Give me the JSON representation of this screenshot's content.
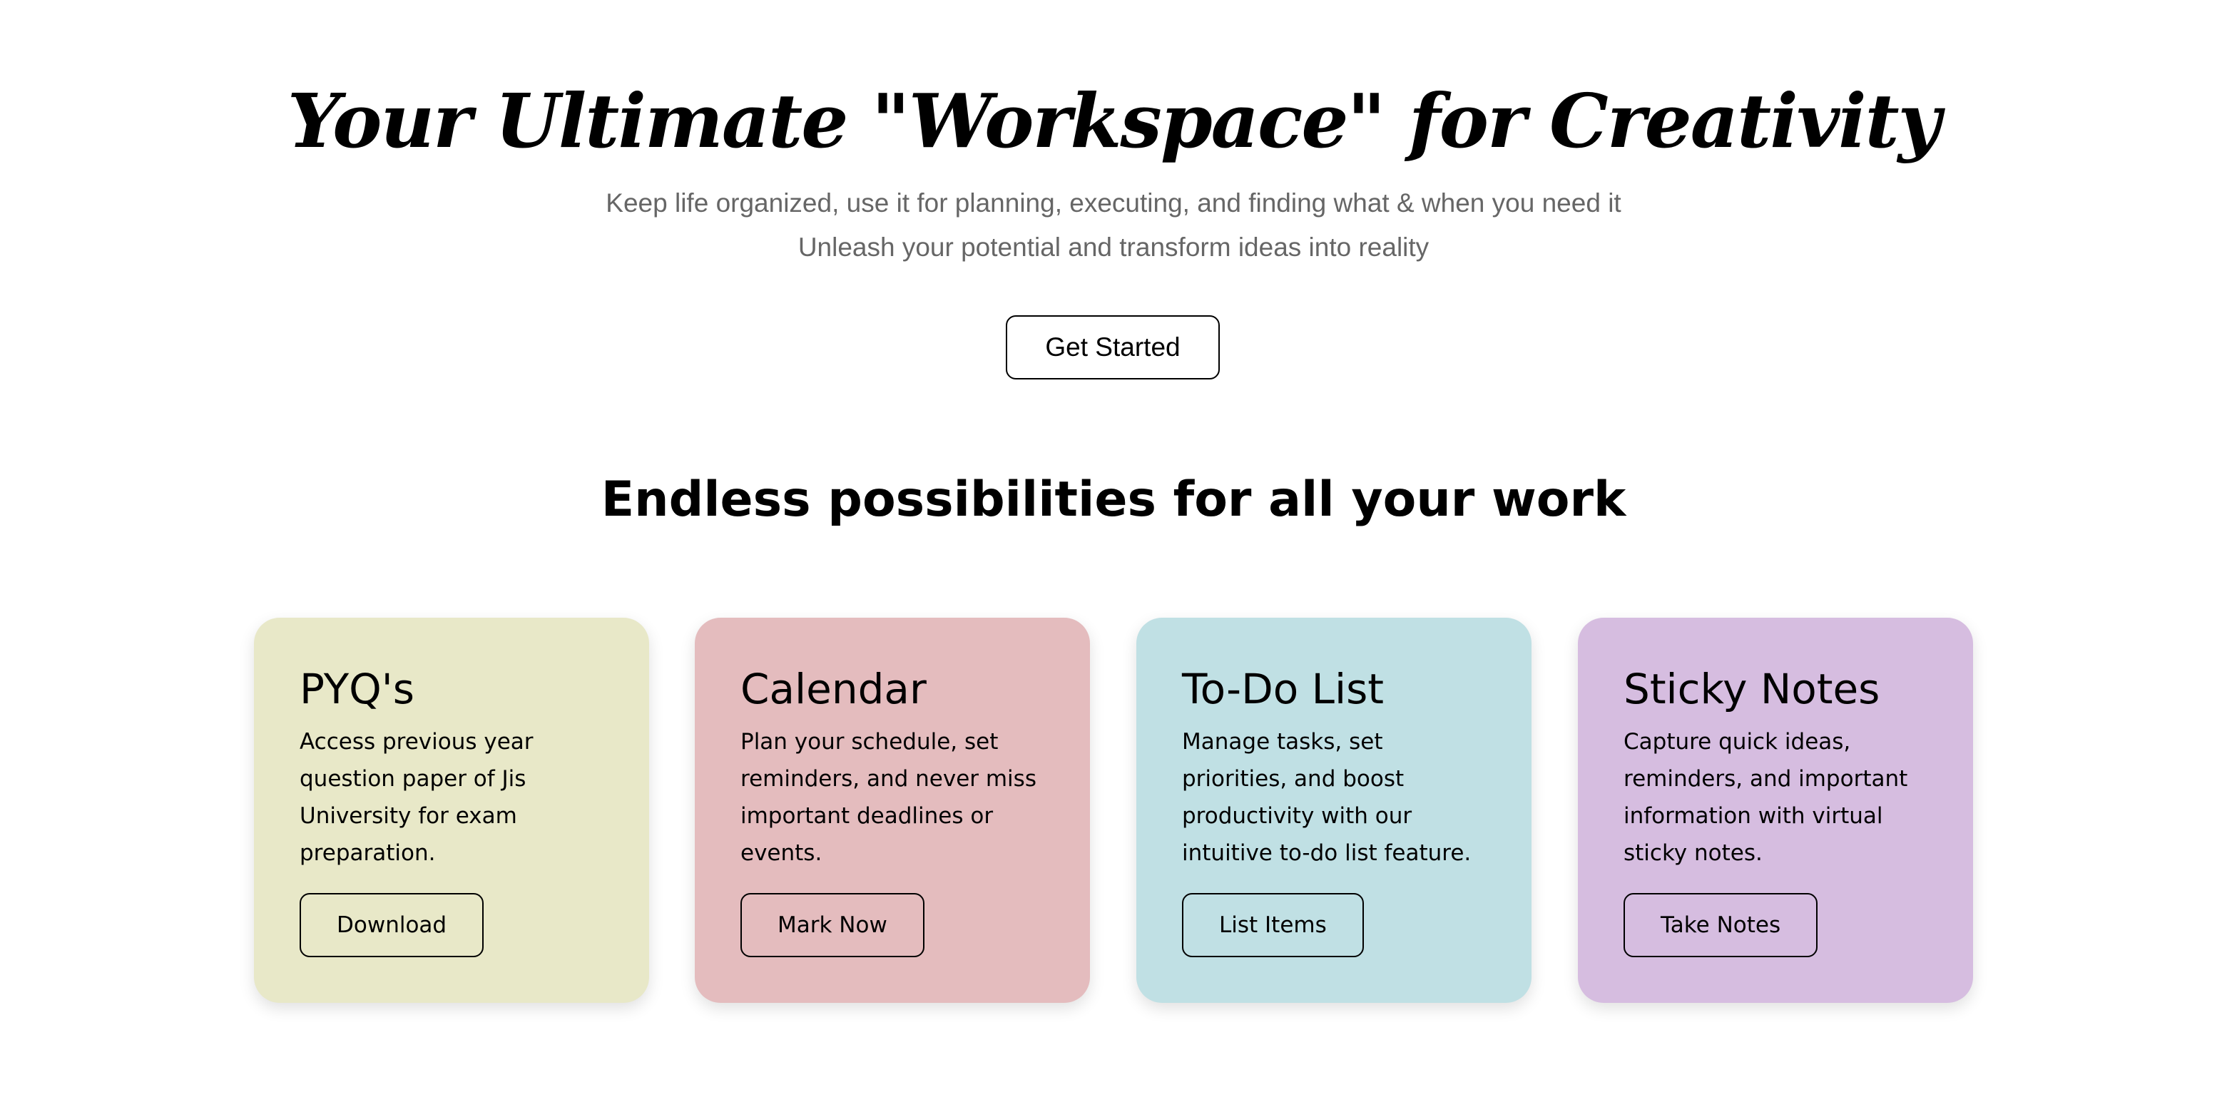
{
  "hero": {
    "title": "Your Ultimate \"Workspace\" for Creativity",
    "subtitle_line1": "Keep life organized, use it for planning, executing, and finding what & when you need it",
    "subtitle_line2": "Unleash your potential and transform ideas into reality",
    "cta_label": "Get Started"
  },
  "features": {
    "heading": "Endless possibilities for all your work",
    "cards": [
      {
        "title": "PYQ's",
        "description": "Access previous year question paper of Jis University for exam preparation.",
        "button_label": "Download",
        "color": "#e8e8c8"
      },
      {
        "title": "Calendar",
        "description": "Plan your schedule, set reminders, and never miss important deadlines or events.",
        "button_label": "Mark Now",
        "color": "#e4bcbe"
      },
      {
        "title": "To-Do List",
        "description": "Manage tasks, set priorities, and boost productivity with our intuitive to-do list feature.",
        "button_label": "List Items",
        "color": "#c0e0e4"
      },
      {
        "title": "Sticky Notes",
        "description": "Capture quick ideas, reminders, and important information with virtual sticky notes.",
        "button_label": "Take Notes",
        "color": "#d6bde0"
      }
    ]
  }
}
